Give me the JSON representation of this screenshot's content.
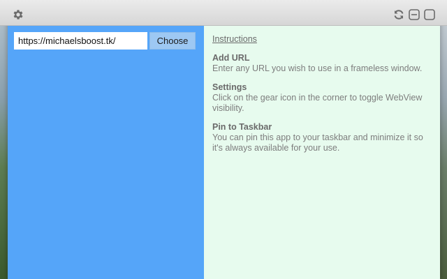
{
  "window": {
    "icons": {
      "settings": "gear-icon",
      "refresh": "refresh-icon",
      "minimize": "minimize-icon",
      "maximize": "maximize-icon"
    }
  },
  "url_bar": {
    "value": "https://michaelsboost.tk/",
    "button_label": "Choose"
  },
  "instructions": {
    "link_label": "Instructions",
    "sections": [
      {
        "title": "Add URL",
        "body": "Enter any URL you wish to use in a frameless window."
      },
      {
        "title": "Settings",
        "body": "Click on the gear icon in the corner to toggle WebView visibility."
      },
      {
        "title": "Pin to Taskbar",
        "body": "You can pin this app to your taskbar and minimize it so it's always available for your use."
      }
    ]
  },
  "colors": {
    "left_pane": "#55a5f9",
    "right_pane": "#e7fbee",
    "button": "#9dc8f3"
  }
}
